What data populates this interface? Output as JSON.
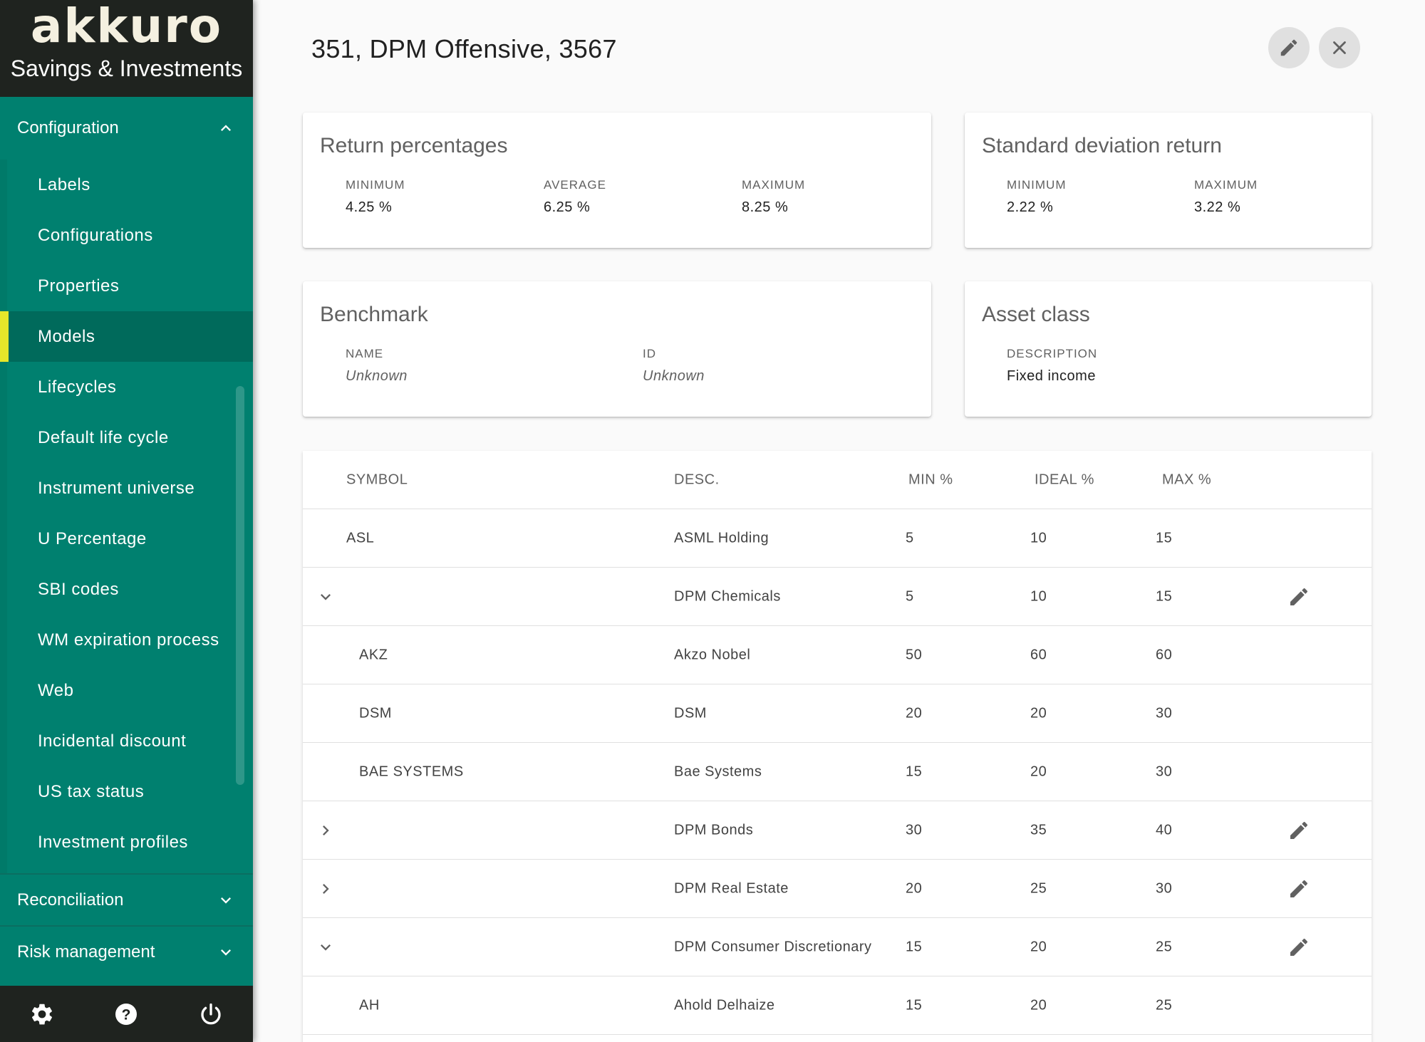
{
  "brand": {
    "logo": "akkuro",
    "subtitle": "Savings & Investments"
  },
  "sidebar": {
    "config_group": "Configuration",
    "items": [
      {
        "label": "Labels"
      },
      {
        "label": "Configurations"
      },
      {
        "label": "Properties"
      },
      {
        "label": "Models",
        "active": true
      },
      {
        "label": "Lifecycles"
      },
      {
        "label": "Default life cycle"
      },
      {
        "label": "Instrument universe"
      },
      {
        "label": "U Percentage"
      },
      {
        "label": "SBI codes"
      },
      {
        "label": "WM expiration process"
      },
      {
        "label": "Web"
      },
      {
        "label": "Incidental discount"
      },
      {
        "label": "US tax status"
      },
      {
        "label": "Investment profiles"
      }
    ],
    "reconciliation": "Reconciliation",
    "risk_management": "Risk management"
  },
  "page": {
    "title": "351, DPM Offensive, 3567"
  },
  "return_card": {
    "title": "Return percentages",
    "min_label": "MINIMUM",
    "min": "4.25 %",
    "avg_label": "AVERAGE",
    "avg": "6.25 %",
    "max_label": "MAXIMUM",
    "max": "8.25 %"
  },
  "stddev_card": {
    "title": "Standard deviation return",
    "min_label": "MINIMUM",
    "min": "2.22 %",
    "max_label": "MAXIMUM",
    "max": "3.22 %"
  },
  "benchmark_card": {
    "title": "Benchmark",
    "name_label": "NAME",
    "name": "Unknown",
    "id_label": "ID",
    "id": "Unknown"
  },
  "asset_card": {
    "title": "Asset class",
    "desc_label": "DESCRIPTION",
    "desc": "Fixed income"
  },
  "table": {
    "headers": {
      "symbol": "SYMBOL",
      "desc": "DESC.",
      "min": "MIN %",
      "ideal": "IDEAL %",
      "max": "MAX %"
    },
    "rows": [
      {
        "symbol": "ASL",
        "desc": "ASML Holding",
        "min": "5",
        "ideal": "10",
        "max": "15"
      },
      {
        "expander": "expanded",
        "symbol": "",
        "desc": "DPM Chemicals",
        "min": "5",
        "ideal": "10",
        "max": "15",
        "editable": true
      },
      {
        "symbol": "AKZ",
        "desc": "Akzo Nobel",
        "min": "50",
        "ideal": "60",
        "max": "60",
        "child": true
      },
      {
        "symbol": "DSM",
        "desc": "DSM",
        "min": "20",
        "ideal": "20",
        "max": "30",
        "child": true
      },
      {
        "symbol": "BAE SYSTEMS",
        "desc": "Bae Systems",
        "min": "15",
        "ideal": "20",
        "max": "30",
        "child": true
      },
      {
        "expander": "collapsed",
        "symbol": "",
        "desc": "DPM Bonds",
        "min": "30",
        "ideal": "35",
        "max": "40",
        "editable": true
      },
      {
        "expander": "collapsed",
        "symbol": "",
        "desc": "DPM Real Estate",
        "min": "20",
        "ideal": "25",
        "max": "30",
        "editable": true
      },
      {
        "expander": "expanded",
        "symbol": "",
        "desc": "DPM Consumer Discretionary",
        "min": "15",
        "ideal": "20",
        "max": "25",
        "editable": true
      },
      {
        "symbol": "AH",
        "desc": "Ahold Delhaize",
        "min": "15",
        "ideal": "20",
        "max": "25",
        "child": true
      }
    ]
  },
  "colors": {
    "sidebar": "#00806f",
    "active_item": "#006a5b",
    "active_marker": "#e6e62a",
    "brand_bg": "#1f231f"
  },
  "icons": [
    "chevron-up-icon",
    "chevron-down-icon",
    "chevron-right-icon",
    "pencil-icon",
    "close-icon",
    "gear-icon",
    "help-icon",
    "power-icon"
  ]
}
